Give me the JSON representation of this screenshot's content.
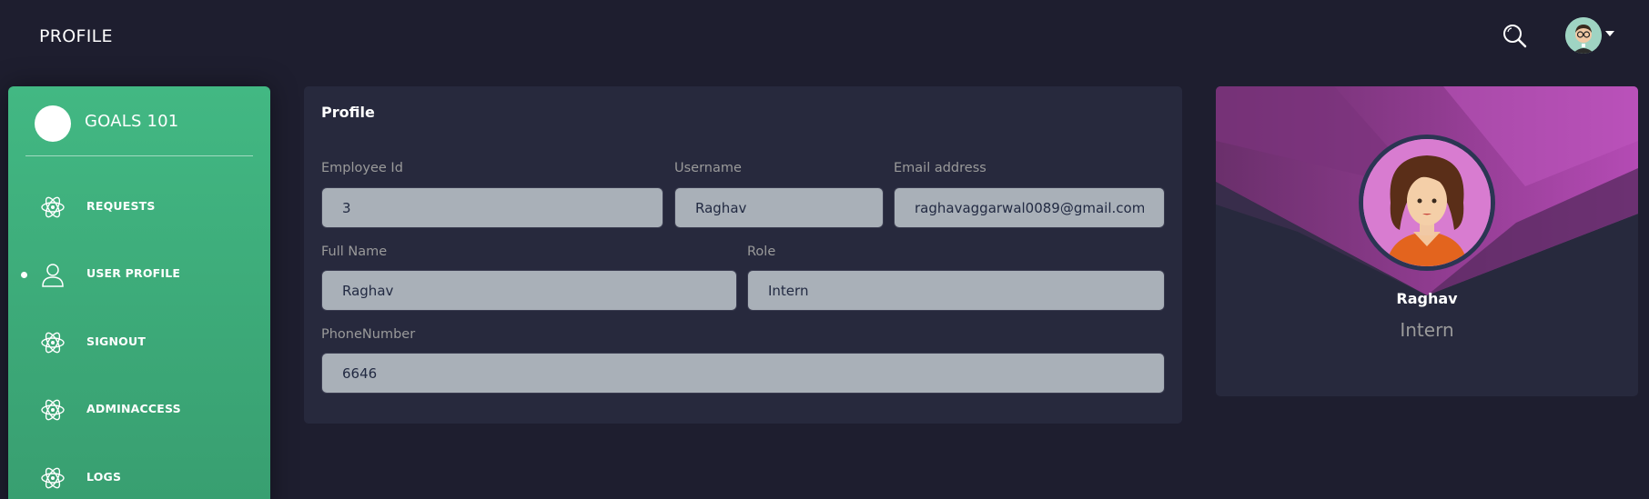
{
  "navbar": {
    "title": "PROFILE",
    "search_icon": "search-icon",
    "avatar_icon": "user-avatar-icon"
  },
  "sidebar": {
    "logo_text": "GOALS 101",
    "items": [
      {
        "label": "REQUESTS",
        "icon": "atom-icon",
        "active": false
      },
      {
        "label": "USER PROFILE",
        "icon": "person-icon",
        "active": true
      },
      {
        "label": "SIGNOUT",
        "icon": "atom-icon",
        "active": false
      },
      {
        "label": "ADMINACCESS",
        "icon": "atom-icon",
        "active": false
      },
      {
        "label": "LOGS",
        "icon": "atom-icon",
        "active": false
      }
    ]
  },
  "profile_form": {
    "title": "Profile",
    "employee_id": {
      "label": "Employee Id",
      "value": "3"
    },
    "username": {
      "label": "Username",
      "value": "Raghav"
    },
    "email": {
      "label": "Email address",
      "value": "raghavaggarwal0089@gmail.com"
    },
    "full_name": {
      "label": "Full Name",
      "value": "Raghav"
    },
    "role": {
      "label": "Role",
      "value": "Intern"
    },
    "phone": {
      "label": "PhoneNumber",
      "value": "6646"
    }
  },
  "user_card": {
    "name": "Raghav",
    "role": "Intern"
  },
  "colors": {
    "background": "#1e1e2f",
    "card": "#27293d",
    "sidebar_top": "#42b883",
    "sidebar_bottom": "#389e70",
    "banner_accent": "#b44bb4",
    "input_bg": "#a9b0b8"
  }
}
